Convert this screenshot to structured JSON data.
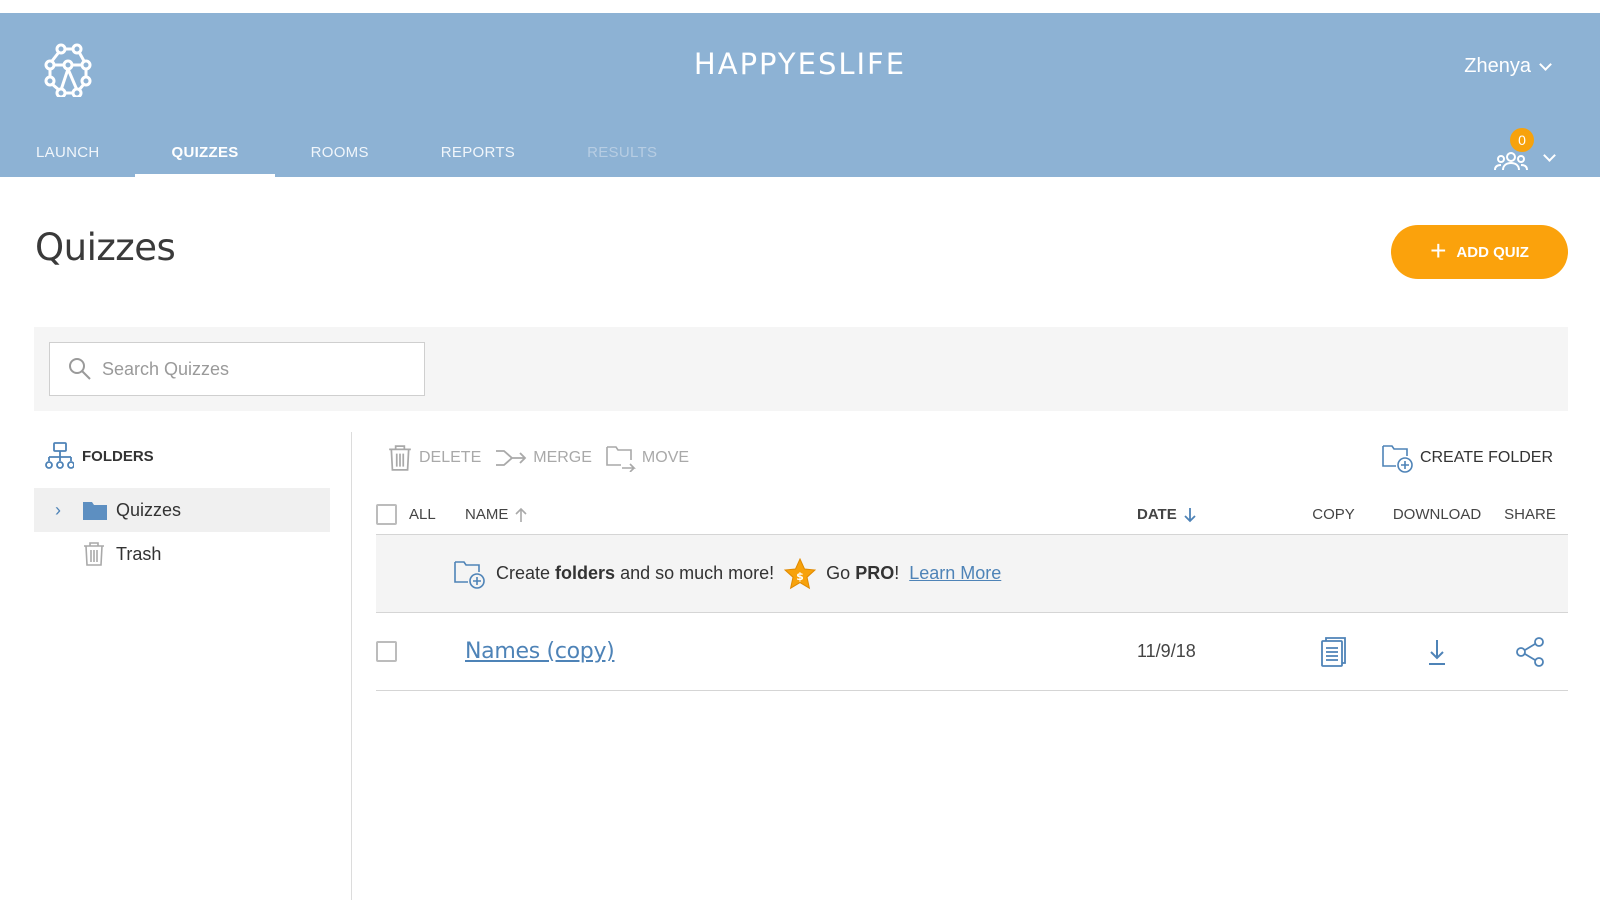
{
  "header": {
    "app_title": "HAPPYESLIFE",
    "user_name": "Zhenya",
    "rooms_badge_count": "0",
    "nav": [
      {
        "label": "LAUNCH"
      },
      {
        "label": "QUIZZES"
      },
      {
        "label": "ROOMS"
      },
      {
        "label": "REPORTS"
      },
      {
        "label": "RESULTS"
      }
    ]
  },
  "page": {
    "title": "Quizzes",
    "add_button_label": "ADD QUIZ"
  },
  "search": {
    "placeholder": "Search Quizzes"
  },
  "sidebar": {
    "heading": "FOLDERS",
    "items": [
      {
        "label": "Quizzes"
      },
      {
        "label": "Trash"
      }
    ]
  },
  "toolbar": {
    "delete_label": "DELETE",
    "merge_label": "MERGE",
    "move_label": "MOVE",
    "create_folder_label": "CREATE FOLDER"
  },
  "table": {
    "headers": {
      "all": "ALL",
      "name": "NAME",
      "date": "DATE",
      "copy": "COPY",
      "download": "DOWNLOAD",
      "share": "SHARE"
    },
    "promo": {
      "text_1": "Create",
      "text_bold_1": "folders",
      "text_2": "and so much more!",
      "text_3": "Go",
      "text_bold_2": "PRO",
      "text_4": "!",
      "link": "Learn More"
    },
    "rows": [
      {
        "name": "Names (copy)",
        "date": "11/9/18"
      }
    ]
  },
  "colors": {
    "header_bg": "#8db2d4",
    "accent_orange": "#fba20c",
    "link_blue": "#4e83b7"
  }
}
